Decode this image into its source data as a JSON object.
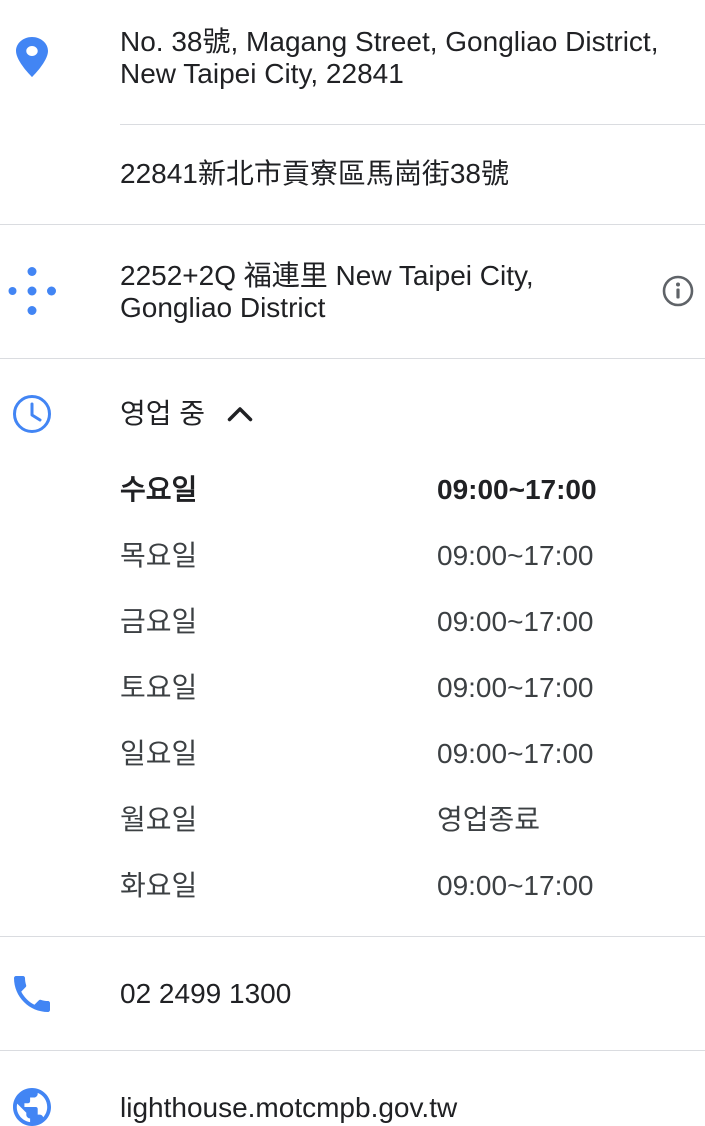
{
  "address": {
    "lines": [
      "No. 38號, Magang Street, Gongliao District,",
      "New Taipei City, 22841"
    ],
    "local": "22841新北市貢寮區馬崗街38號"
  },
  "plus_code": {
    "lines": [
      "2252+2Q 福連里 New Taipei City,",
      "Gongliao District"
    ]
  },
  "hours": {
    "status": "영업 중",
    "days": [
      {
        "day": "수요일",
        "hours": "09:00~17:00",
        "today": true
      },
      {
        "day": "목요일",
        "hours": "09:00~17:00",
        "today": false
      },
      {
        "day": "금요일",
        "hours": "09:00~17:00",
        "today": false
      },
      {
        "day": "토요일",
        "hours": "09:00~17:00",
        "today": false
      },
      {
        "day": "일요일",
        "hours": "09:00~17:00",
        "today": false
      },
      {
        "day": "월요일",
        "hours": "영업종료",
        "today": false
      },
      {
        "day": "화요일",
        "hours": "09:00~17:00",
        "today": false
      }
    ]
  },
  "phone": {
    "number": "02 2499 1300"
  },
  "website": {
    "url": "lighthouse.motcmpb.gov.tw"
  },
  "icons": {
    "address": "location-pin-icon",
    "plus_code": "plus-code-icon",
    "plus_code_info": "info-icon",
    "hours": "clock-icon",
    "hours_toggle": "chevron-up-icon",
    "phone": "phone-icon",
    "website": "globe-icon"
  },
  "colors": {
    "icon_accent": "#4285f4",
    "text_primary": "#202124",
    "text_secondary": "#3c4043",
    "icon_neutral": "#5f6368",
    "divider": "#dadce0",
    "background": "#ffffff"
  }
}
